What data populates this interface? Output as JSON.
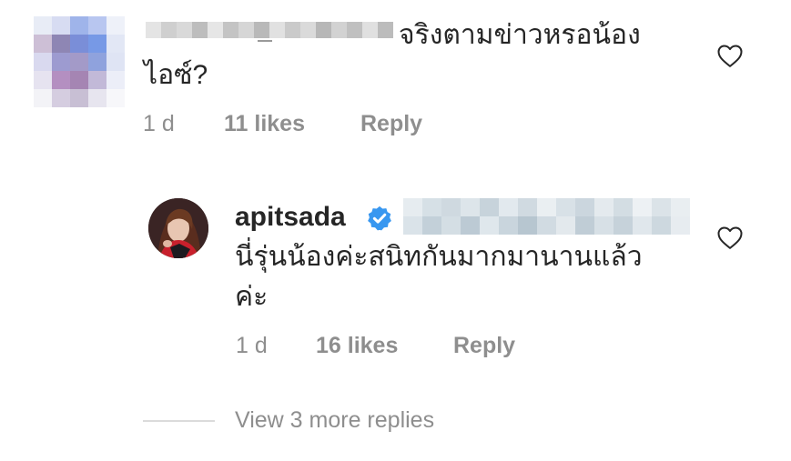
{
  "comment1": {
    "text_line1": "จริงตามข่าวหรอน้อง",
    "text_line2": "ไอซ์?",
    "age": "1 d",
    "likes": "11 likes",
    "reply_label": "Reply"
  },
  "comment2": {
    "username": "apitsada",
    "text_line1": "นี่รุ่นน้องค่ะสนิทกันมากมานานแล้ว",
    "text_line2": "ค่ะ",
    "age": "1 d",
    "likes": "16 likes",
    "reply_label": "Reply"
  },
  "view_more": "View 3 more replies",
  "icons": {
    "like": "heart-outline-icon",
    "verified": "verified-badge-icon"
  },
  "colors": {
    "text": "#262626",
    "secondary": "#8e8e8e",
    "verified": "#3897f0"
  }
}
